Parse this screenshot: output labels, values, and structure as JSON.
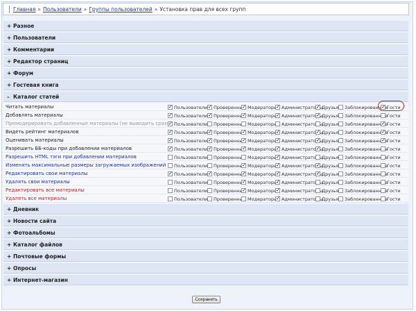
{
  "breadcrumb": {
    "items": [
      "Главная",
      "Пользователи",
      "Группы пользователей"
    ],
    "current": "Установка прав для всех групп",
    "separator": "»"
  },
  "sections_top": [
    {
      "label": "Разное",
      "expanded": false
    },
    {
      "label": "Пользователи",
      "expanded": false
    },
    {
      "label": "Комментарии",
      "expanded": false
    },
    {
      "label": "Редактор страниц",
      "expanded": false
    },
    {
      "label": "Форум",
      "expanded": false
    },
    {
      "label": "Гостевая книга",
      "expanded": false
    }
  ],
  "open_section": {
    "label": "Каталог статей",
    "expanded": true
  },
  "groups": [
    "Пользователи",
    "Проверенные",
    "Модераторы",
    "Администраторы",
    "Друзья",
    "Заблокированные",
    "Гости"
  ],
  "permissions": [
    {
      "label": "Читать материалы",
      "color": "dark",
      "checked": [
        true,
        true,
        true,
        true,
        true,
        false,
        true
      ]
    },
    {
      "label": "Добавлять материалы",
      "color": "dark",
      "checked": [
        true,
        true,
        true,
        true,
        true,
        false,
        false
      ]
    },
    {
      "label": "Премодерировать добавленные материалы (не выводить сразу)",
      "color": "gray",
      "warn": "!",
      "checked": [
        true,
        false,
        false,
        false,
        false,
        false,
        true
      ]
    },
    {
      "label": "Видеть рейтинг материалов",
      "color": "dark",
      "checked": [
        true,
        true,
        true,
        true,
        true,
        false,
        true
      ]
    },
    {
      "label": "Оценивать материалы",
      "color": "dark",
      "checked": [
        true,
        true,
        true,
        true,
        true,
        false,
        true
      ]
    },
    {
      "label": "Разрешить ББ-коды при добавлении материалов",
      "color": "dark",
      "checked": [
        true,
        true,
        true,
        true,
        true,
        false,
        false
      ]
    },
    {
      "label": "Разрешить HTML тэги при добавлении материалов",
      "color": "blue",
      "checked": [
        false,
        false,
        false,
        true,
        false,
        false,
        false
      ]
    },
    {
      "label": "Изменять максимальные размеры загружаемых изображений",
      "color": "blue",
      "checked": [
        false,
        false,
        true,
        true,
        true,
        false,
        false
      ]
    },
    {
      "label": "Редактировать свои материалы",
      "color": "blue",
      "checked": [
        true,
        true,
        true,
        true,
        true,
        false,
        false
      ]
    },
    {
      "label": "Удалять свои материалы",
      "color": "blue",
      "checked": [
        false,
        false,
        true,
        true,
        false,
        false,
        false
      ]
    },
    {
      "label": "Редактировать все материалы",
      "color": "red",
      "checked": [
        false,
        false,
        true,
        true,
        false,
        false,
        false
      ]
    },
    {
      "label": "Удалять все материалы",
      "color": "red",
      "checked": [
        false,
        false,
        false,
        true,
        false,
        false,
        false
      ]
    }
  ],
  "sections_bottom": [
    {
      "label": "Дневник",
      "expanded": false
    },
    {
      "label": "Новости сайта",
      "expanded": false
    },
    {
      "label": "Фотоальбомы",
      "expanded": false
    },
    {
      "label": "Каталог файлов",
      "expanded": false
    },
    {
      "label": "Почтовые формы",
      "expanded": false
    },
    {
      "label": "Опросы",
      "expanded": false
    },
    {
      "label": "Интернет-магазин",
      "expanded": false
    }
  ],
  "save_label": "Сохранить",
  "symbols": {
    "plus": "+",
    "minus": "–",
    "check": "✓"
  },
  "colors": {
    "accent_link": "#1a3c8a",
    "section_bg": "#dfe6f3",
    "highlight_circle": "#d51b1b"
  }
}
